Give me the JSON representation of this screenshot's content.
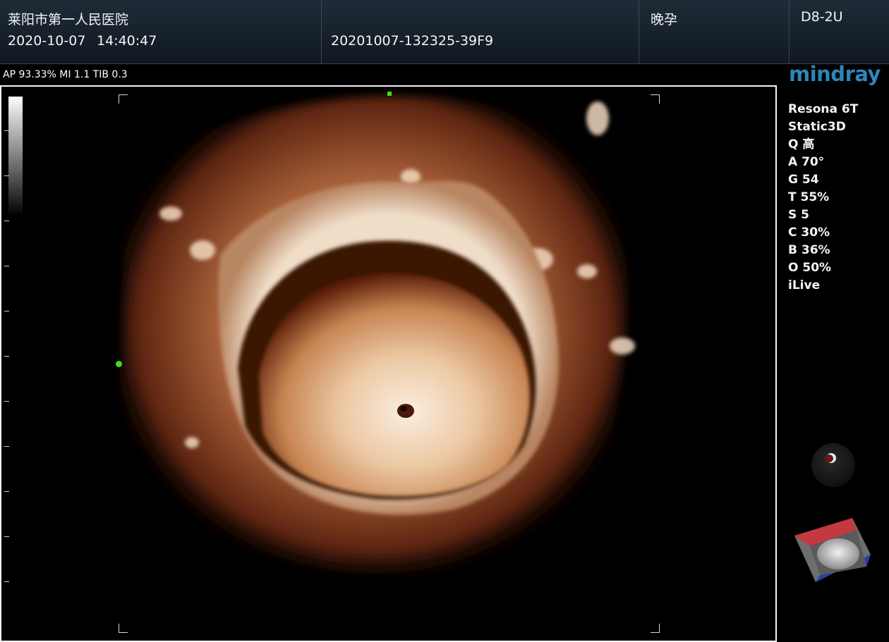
{
  "header": {
    "hospital": "莱阳市第一人民医院",
    "date": "2020-10-07",
    "time": "14:40:47",
    "study_id": "20201007-132325-39F9",
    "exam": "晚孕",
    "probe": "D8-2U"
  },
  "acoustic_info": "AP 93.33%  MI 1.1 TIB 0.3",
  "brand": {
    "logo": "mindray",
    "color": "#2e86b6"
  },
  "parameters": [
    "Resona 6T",
    " Static3D",
    "Q 高",
    "A 70°",
    "G 54",
    "T 55%",
    "S 5",
    "C 30%",
    "B 36%",
    "O 50%",
    "iLive"
  ],
  "colors": {
    "cursor_marker": "#3ee01b",
    "orientation_red": "#c4383f",
    "orientation_blue": "#2d3fa6",
    "tissue_dark": "#5a1d08",
    "tissue_mid": "#b06a3e",
    "tissue_light": "#f3dcc0"
  },
  "icons": [
    "rotation-knob-icon",
    "orientation-cube-icon"
  ]
}
